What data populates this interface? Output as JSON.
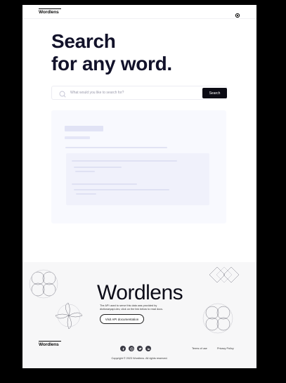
{
  "header": {
    "logo": "Wordlens",
    "theme_toggle_icon": "sun-icon"
  },
  "hero": {
    "title_line1": "Search",
    "title_line2": "for any word."
  },
  "search": {
    "placeholder": "What would you like to search for?",
    "button_label": "Search",
    "icon": "search-icon"
  },
  "footer": {
    "brand": "Wordlens",
    "description": "The API used to serve this data was provided by dictionaryapi.dev, click on the link below to read docs.",
    "api_button_label": "Visit API documentation",
    "logo": "Wordlens",
    "socials": [
      "facebook-icon",
      "instagram-icon",
      "twitter-icon",
      "linkedin-icon"
    ],
    "terms_label": "Terms of use",
    "privacy_label": "Privacy Policy",
    "copyright": "Copyright © 2023 Wordlens. All rights reserved."
  },
  "colors": {
    "accent_dark": "#0b0b14",
    "skeleton_bg": "#f8f9fe",
    "footer_bg": "#f7f7f8"
  }
}
